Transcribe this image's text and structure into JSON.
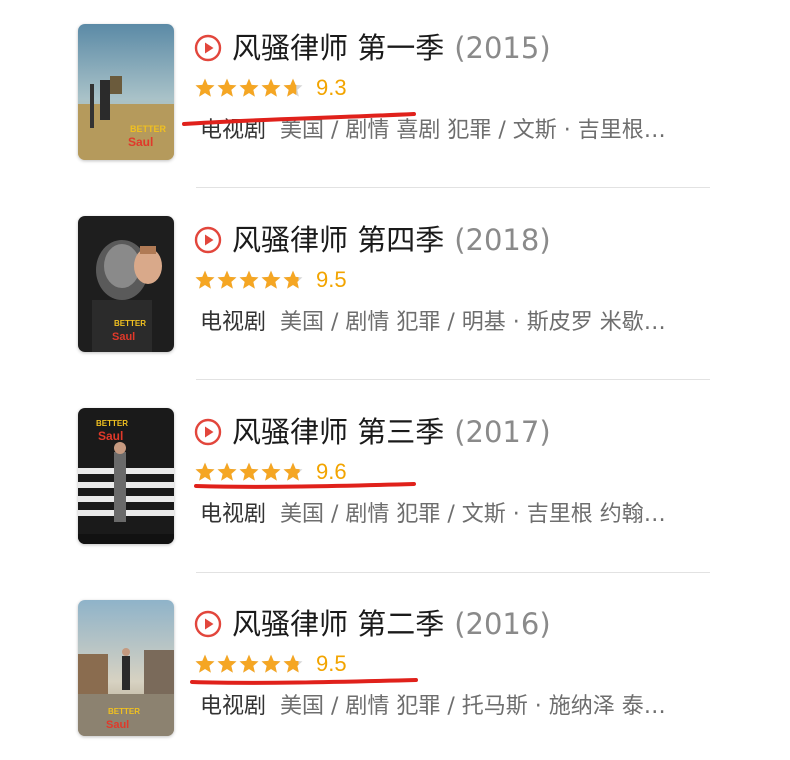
{
  "items": [
    {
      "name": "风骚律师 第一季",
      "year": "(2015)",
      "score": "9.3",
      "rating": 9.3,
      "type": "电视剧",
      "info": "美国 / 剧情 喜剧 犯罪 / 文斯 · 吉里根…",
      "poster_icon": "poster-season1",
      "underlined": true
    },
    {
      "name": "风骚律师 第四季",
      "year": "(2018)",
      "score": "9.5",
      "rating": 9.5,
      "type": "电视剧",
      "info": "美国 / 剧情 犯罪 / 明基 · 斯皮罗 米歇…",
      "poster_icon": "poster-season4",
      "underlined": false
    },
    {
      "name": "风骚律师 第三季",
      "year": "(2017)",
      "score": "9.6",
      "rating": 9.6,
      "type": "电视剧",
      "info": "美国 / 剧情 犯罪 / 文斯 · 吉里根 约翰…",
      "poster_icon": "poster-season3",
      "underlined": true
    },
    {
      "name": "风骚律师 第二季",
      "year": "(2016)",
      "score": "9.5",
      "rating": 9.5,
      "type": "电视剧",
      "info": "美国 / 剧情 犯罪 / 托马斯 · 施纳泽 泰…",
      "poster_icon": "poster-season2",
      "underlined": true
    }
  ],
  "colors": {
    "star": "#f5a623",
    "play": "#e2463c",
    "underline": "#e0211b"
  }
}
